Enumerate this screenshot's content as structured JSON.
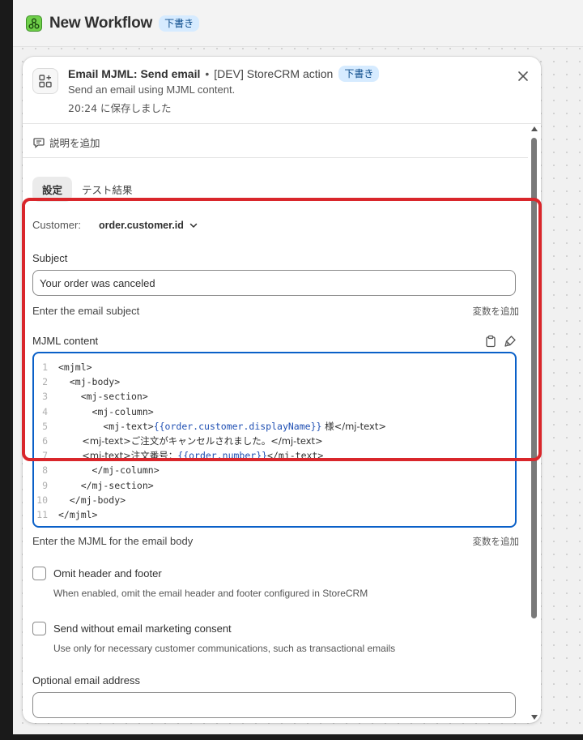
{
  "topbar": {
    "title": "New Workflow",
    "badge": "下書き",
    "icon": "workflow-icon"
  },
  "panel": {
    "header": {
      "action_name": "Email MJML: Send email",
      "separator": "•",
      "source": "[DEV] StoreCRM action",
      "badge": "下書き",
      "description": "Send an email using MJML content.",
      "saved_status": "20:24 に保存しました",
      "icon": "app-grid-icon",
      "close_icon": "close-icon"
    },
    "add_description": "説明を追加",
    "tabs": [
      {
        "label": "設定",
        "active": true
      },
      {
        "label": "テスト結果",
        "active": false
      }
    ],
    "customer": {
      "label": "Customer:",
      "value": "order.customer.id"
    },
    "subject": {
      "label": "Subject",
      "value": "Your order was canceled",
      "help": "Enter the email subject",
      "add_variable": "変数を追加"
    },
    "mjml": {
      "label": "MJML content",
      "help": "Enter the MJML for the email body",
      "add_variable": "変数を追加",
      "lines": [
        {
          "n": "1",
          "pre": "<mjml>",
          "tpl": "",
          "post": ""
        },
        {
          "n": "2",
          "pre": "  <mj-body>",
          "tpl": "",
          "post": ""
        },
        {
          "n": "3",
          "pre": "    <mj-section>",
          "tpl": "",
          "post": ""
        },
        {
          "n": "4",
          "pre": "      <mj-column>",
          "tpl": "",
          "post": ""
        },
        {
          "n": "5",
          "pre": "        <mj-text>",
          "tpl": "{{order.customer.displayName}}",
          "post": " 様</mj-text>"
        },
        {
          "n": "6",
          "pre": "        <mj-text>ご注文がキャンセルされました。</mj-text>",
          "tpl": "",
          "post": ""
        },
        {
          "n": "7",
          "pre": "        <mj-text>注文番号：",
          "tpl": "{{order.number}}",
          "post": "</mj-text>"
        },
        {
          "n": "8",
          "pre": "      </mj-column>",
          "tpl": "",
          "post": ""
        },
        {
          "n": "9",
          "pre": "    </mj-section>",
          "tpl": "",
          "post": ""
        },
        {
          "n": "10",
          "pre": "  </mj-body>",
          "tpl": "",
          "post": ""
        },
        {
          "n": "11",
          "pre": "</mjml>",
          "tpl": "",
          "post": ""
        }
      ]
    },
    "omit_header_footer": {
      "label": "Omit header and footer",
      "help": "When enabled, omit the email header and footer configured in StoreCRM",
      "checked": false
    },
    "without_consent": {
      "label": "Send without email marketing consent",
      "help": "Use only for necessary customer communications, such as transactional emails",
      "checked": false
    },
    "optional_email": {
      "label": "Optional email address",
      "value": ""
    }
  },
  "colors": {
    "badge_bg": "#d6ebff",
    "focus_border": "#0a60c8",
    "highlight": "#d9262b",
    "template_var": "#1f4fb3"
  }
}
